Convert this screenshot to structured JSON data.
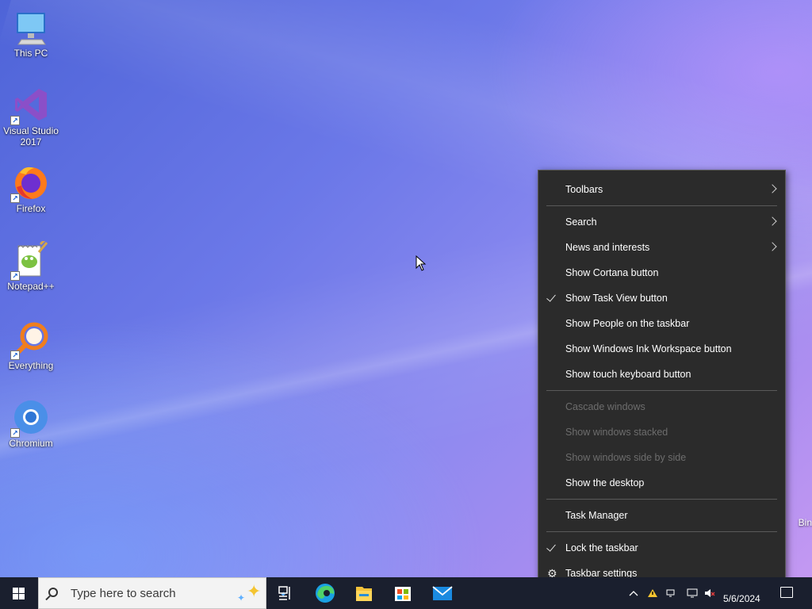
{
  "desktop": {
    "icons": [
      {
        "label": "This PC"
      },
      {
        "label": "Visual Studio 2017"
      },
      {
        "label": "Firefox"
      },
      {
        "label": "Notepad++"
      },
      {
        "label": "Everything"
      },
      {
        "label": "Chromium"
      }
    ],
    "recycle_partial_label": "Bin"
  },
  "context_menu": {
    "items": [
      {
        "label": "Toolbars",
        "submenu": true
      },
      {
        "label": "Search",
        "submenu": true
      },
      {
        "label": "News and interests",
        "submenu": true
      },
      {
        "label": "Show Cortana button"
      },
      {
        "label": "Show Task View button",
        "checked": true
      },
      {
        "label": "Show People on the taskbar"
      },
      {
        "label": "Show Windows Ink Workspace button"
      },
      {
        "label": "Show touch keyboard button"
      },
      {
        "label": "Cascade windows",
        "disabled": true
      },
      {
        "label": "Show windows stacked",
        "disabled": true
      },
      {
        "label": "Show windows side by side",
        "disabled": true
      },
      {
        "label": "Show the desktop"
      },
      {
        "label": "Task Manager"
      },
      {
        "label": "Lock the taskbar",
        "checked": true
      },
      {
        "label": "Taskbar settings",
        "icon": "gear-icon"
      }
    ]
  },
  "taskbar": {
    "search_placeholder": "Type here to search",
    "pinned": [
      {
        "name": "task-view-icon"
      },
      {
        "name": "edge-icon"
      },
      {
        "name": "file-explorer-icon"
      },
      {
        "name": "microsoft-store-icon"
      },
      {
        "name": "mail-icon"
      }
    ],
    "date": "5/6/2024"
  }
}
